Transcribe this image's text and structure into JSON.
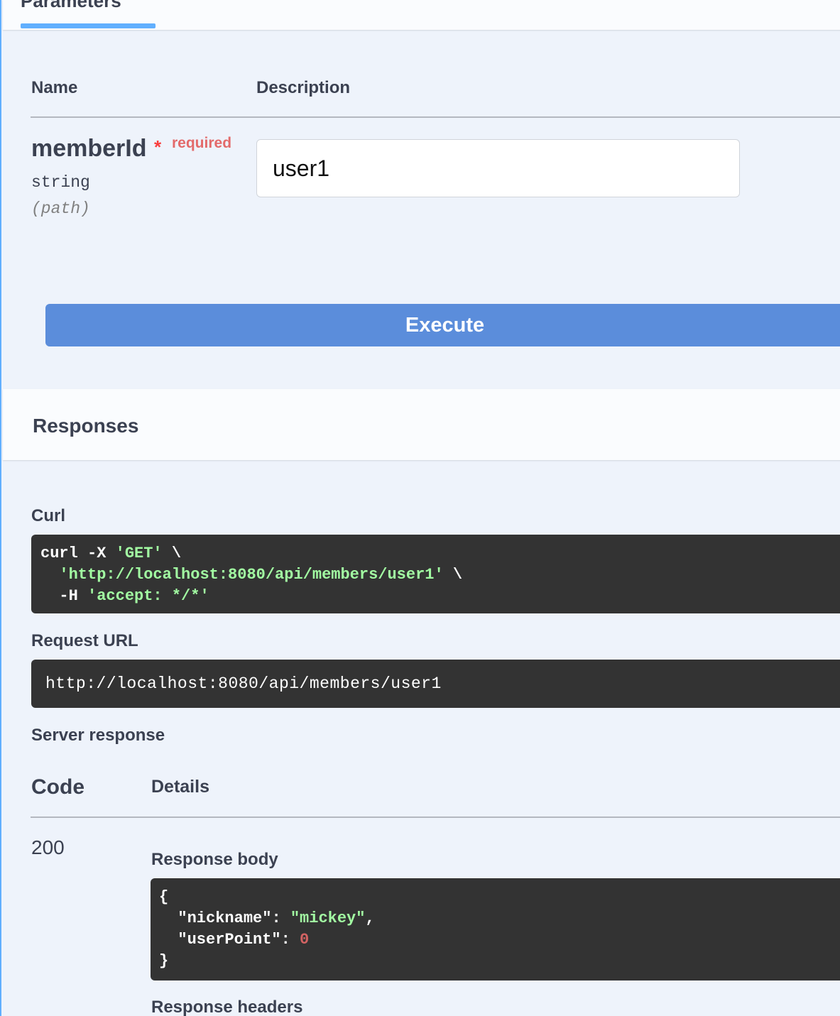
{
  "parameters": {
    "tab_label": "Parameters",
    "col_name": "Name",
    "col_description": "Description",
    "param": {
      "name": "memberId",
      "required_star": "*",
      "required_label": "required",
      "type": "string",
      "location": "(path)",
      "value": "user1"
    },
    "execute_label": "Execute"
  },
  "responses": {
    "title": "Responses",
    "curl_label": "Curl",
    "curl": {
      "line1_cmd": "curl -X ",
      "line1_method": "'GET'",
      "line1_tail": " \\",
      "line2_url": "'http://localhost:8080/api/members/user1'",
      "line2_tail": " \\",
      "line3_flag": "-H ",
      "line3_header": "'accept: */*'"
    },
    "request_url_label": "Request URL",
    "request_url": "http://localhost:8080/api/members/user1",
    "server_response_label": "Server response",
    "col_code": "Code",
    "col_details": "Details",
    "status_code": "200",
    "response_body_label": "Response body",
    "body": {
      "open": "{",
      "nickname_key": "\"nickname\"",
      "nickname_value": "\"mickey\"",
      "userpoint_key": "\"userPoint\"",
      "userpoint_value": "0",
      "close": "}"
    },
    "response_headers_label": "Response headers"
  },
  "colors": {
    "accent": "#61affe",
    "execute": "#5b8ddb",
    "code_bg": "#333333",
    "string": "#a2fca2",
    "number": "#d36363",
    "required": "#f93e3e"
  }
}
